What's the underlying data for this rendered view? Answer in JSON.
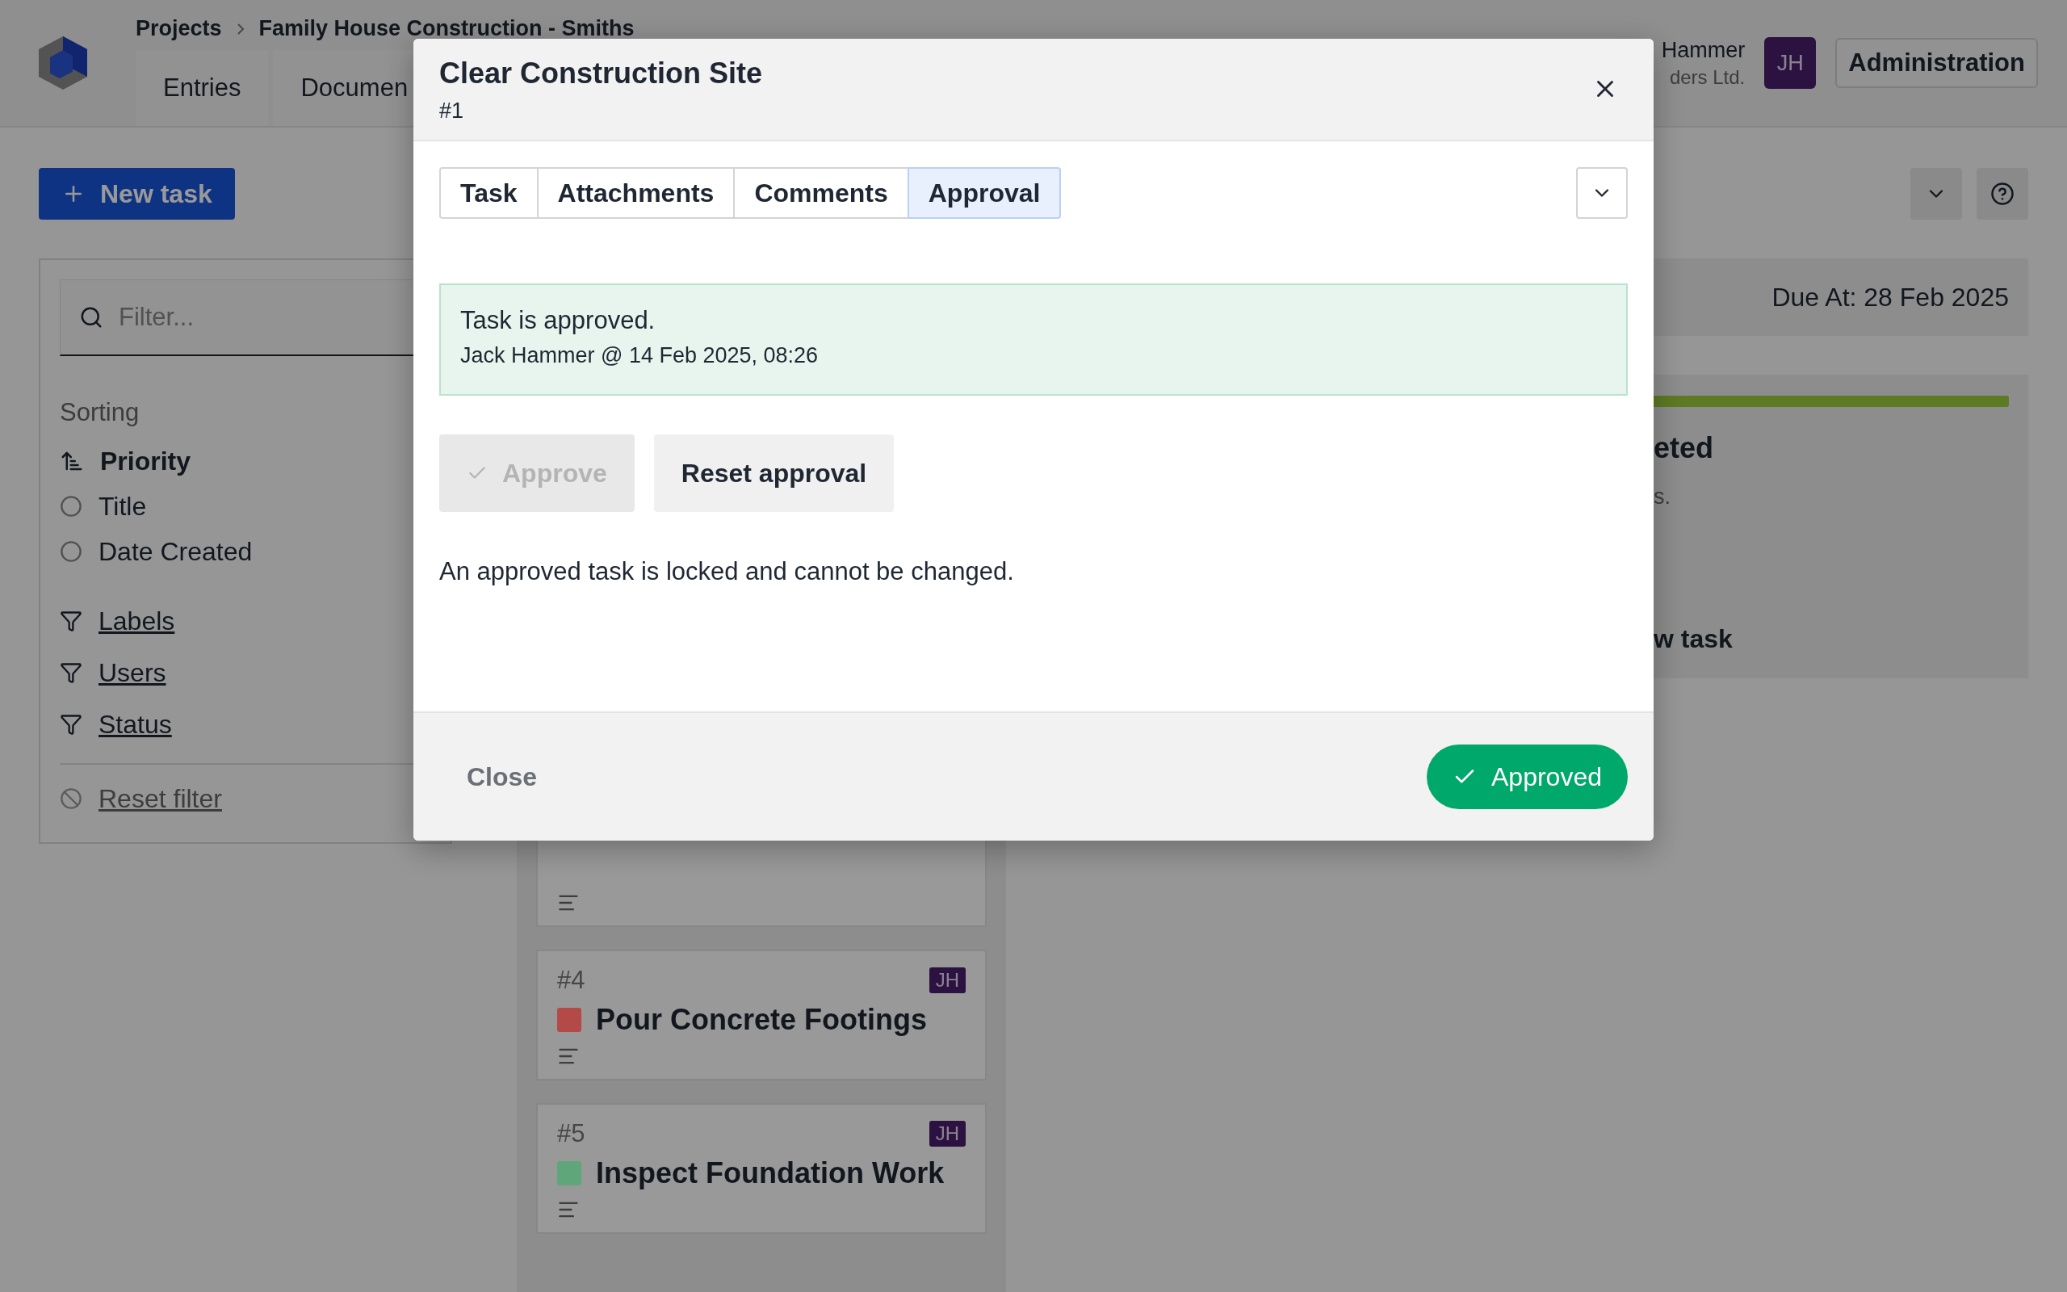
{
  "header": {
    "breadcrumb": [
      "Projects",
      "Family House Construction - Smiths"
    ],
    "nav_tabs": [
      "Entries",
      "Documen"
    ],
    "user": {
      "name": "Hammer",
      "company": "ders Ltd.",
      "initials": "JH"
    },
    "admin_button": "Administration"
  },
  "sidebar": {
    "new_task": "New task",
    "filter": {
      "placeholder": "Filter..."
    },
    "sorting_label": "Sorting",
    "sort_options": [
      {
        "label": "Priority",
        "selected": true
      },
      {
        "label": "Title",
        "selected": false
      },
      {
        "label": "Date Created",
        "selected": false
      }
    ],
    "filters": [
      "Labels",
      "Users",
      "Status"
    ],
    "reset_filter": "Reset filter"
  },
  "board": {
    "cards": [
      {
        "number": "#4",
        "assignee": "JH",
        "title": "Pour Concrete Footings",
        "color": "#b44a48"
      },
      {
        "number": "#5",
        "assignee": "JH",
        "title": "Inspect Foundation Work",
        "color": "#5fa67a"
      }
    ]
  },
  "detail": {
    "due": "Due At: 28 Feb 2025",
    "progress": {
      "level": 1
    },
    "heading": "eted",
    "text": "s.",
    "link": "w task"
  },
  "modal": {
    "title": "Clear Construction Site",
    "number": "#1",
    "tabs": [
      {
        "label": "Task",
        "selected": false
      },
      {
        "label": "Attachments",
        "selected": false
      },
      {
        "label": "Comments",
        "selected": false
      },
      {
        "label": "Approval",
        "selected": true
      }
    ],
    "alert": {
      "title": "Task is approved.",
      "meta": "Jack Hammer @ 14 Feb 2025, 08:26"
    },
    "actions": [
      {
        "label": "Approve",
        "disabled": true
      },
      {
        "label": "Reset approval",
        "disabled": false
      }
    ],
    "note": "An approved task is locked and cannot be changed.",
    "footer": {
      "close": "Close",
      "status": "Approved"
    }
  }
}
